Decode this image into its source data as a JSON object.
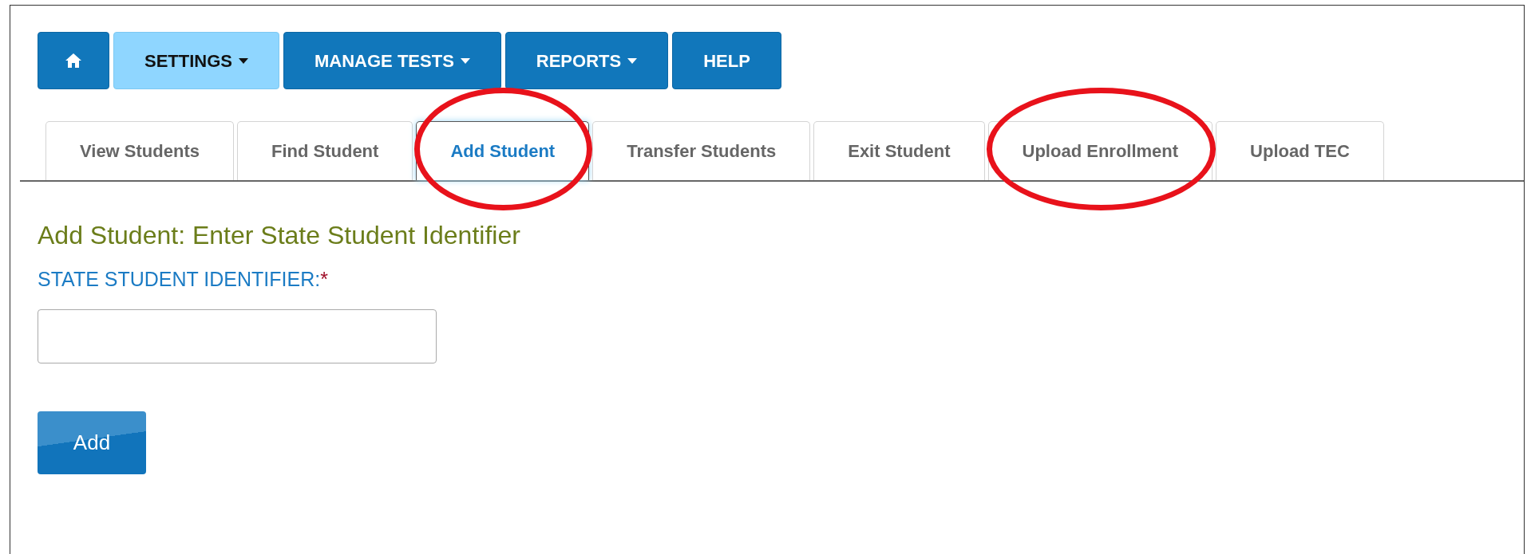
{
  "nav": [
    {
      "kind": "home",
      "selected": false
    },
    {
      "kind": "dropdown",
      "label": "SETTINGS",
      "selected": true
    },
    {
      "kind": "dropdown",
      "label": "MANAGE TESTS",
      "selected": false
    },
    {
      "kind": "dropdown",
      "label": "REPORTS",
      "selected": false
    },
    {
      "kind": "link",
      "label": "HELP",
      "selected": false
    }
  ],
  "tabs": [
    {
      "label": "View Students",
      "selected": false,
      "circled": false
    },
    {
      "label": "Find Student",
      "selected": false,
      "circled": false
    },
    {
      "label": "Add Student",
      "selected": true,
      "circled": true
    },
    {
      "label": "Transfer Students",
      "selected": false,
      "circled": false
    },
    {
      "label": "Exit Student",
      "selected": false,
      "circled": false
    },
    {
      "label": "Upload Enrollment",
      "selected": false,
      "circled": true
    },
    {
      "label": "Upload TEC",
      "selected": false,
      "circled": false
    }
  ],
  "heading": "Add Student: Enter State Student Identifier",
  "field": {
    "label": "STATE STUDENT IDENTIFIER:",
    "required_mark": "*"
  },
  "submit_button": "Add"
}
